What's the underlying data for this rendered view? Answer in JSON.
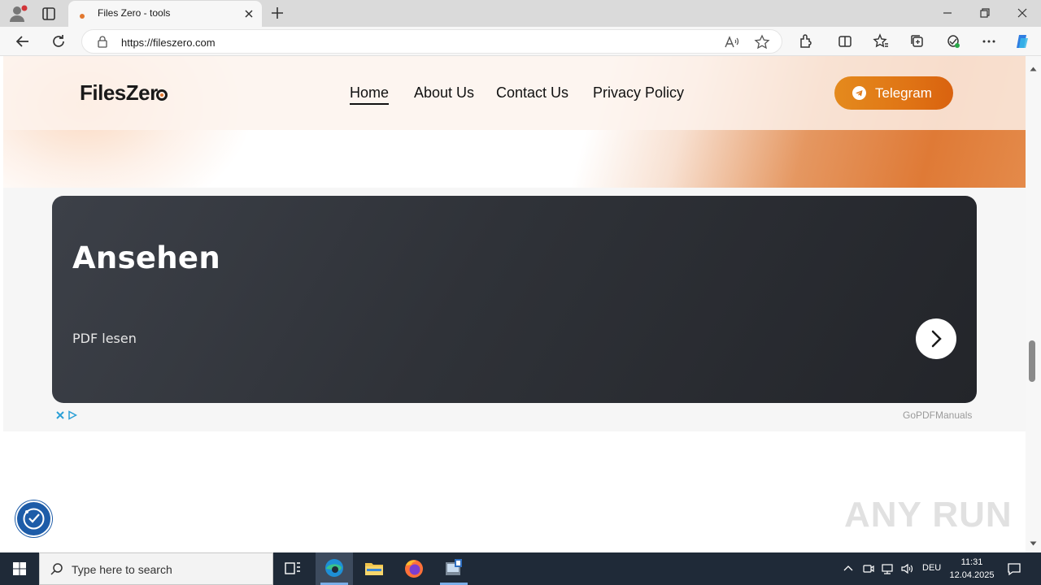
{
  "browser": {
    "tab_title": "Files Zero - tools",
    "url": "https://fileszero.com"
  },
  "site": {
    "logo_text": "FilesZer",
    "nav": {
      "home": "Home",
      "about": "About Us",
      "contact": "Contact Us",
      "privacy": "Privacy Policy"
    },
    "telegram_label": "Telegram"
  },
  "ad": {
    "title": "Ansehen",
    "subtitle": "PDF lesen",
    "source": "GoPDFManuals"
  },
  "watermark": "ANY RUN",
  "taskbar": {
    "search_placeholder": "Type here to search",
    "language": "DEU",
    "time": "11:31",
    "date": "12.04.2025"
  },
  "colors": {
    "accent_orange": "#e07515",
    "taskbar": "#1f2a38",
    "ad_card": "#2f3238"
  }
}
